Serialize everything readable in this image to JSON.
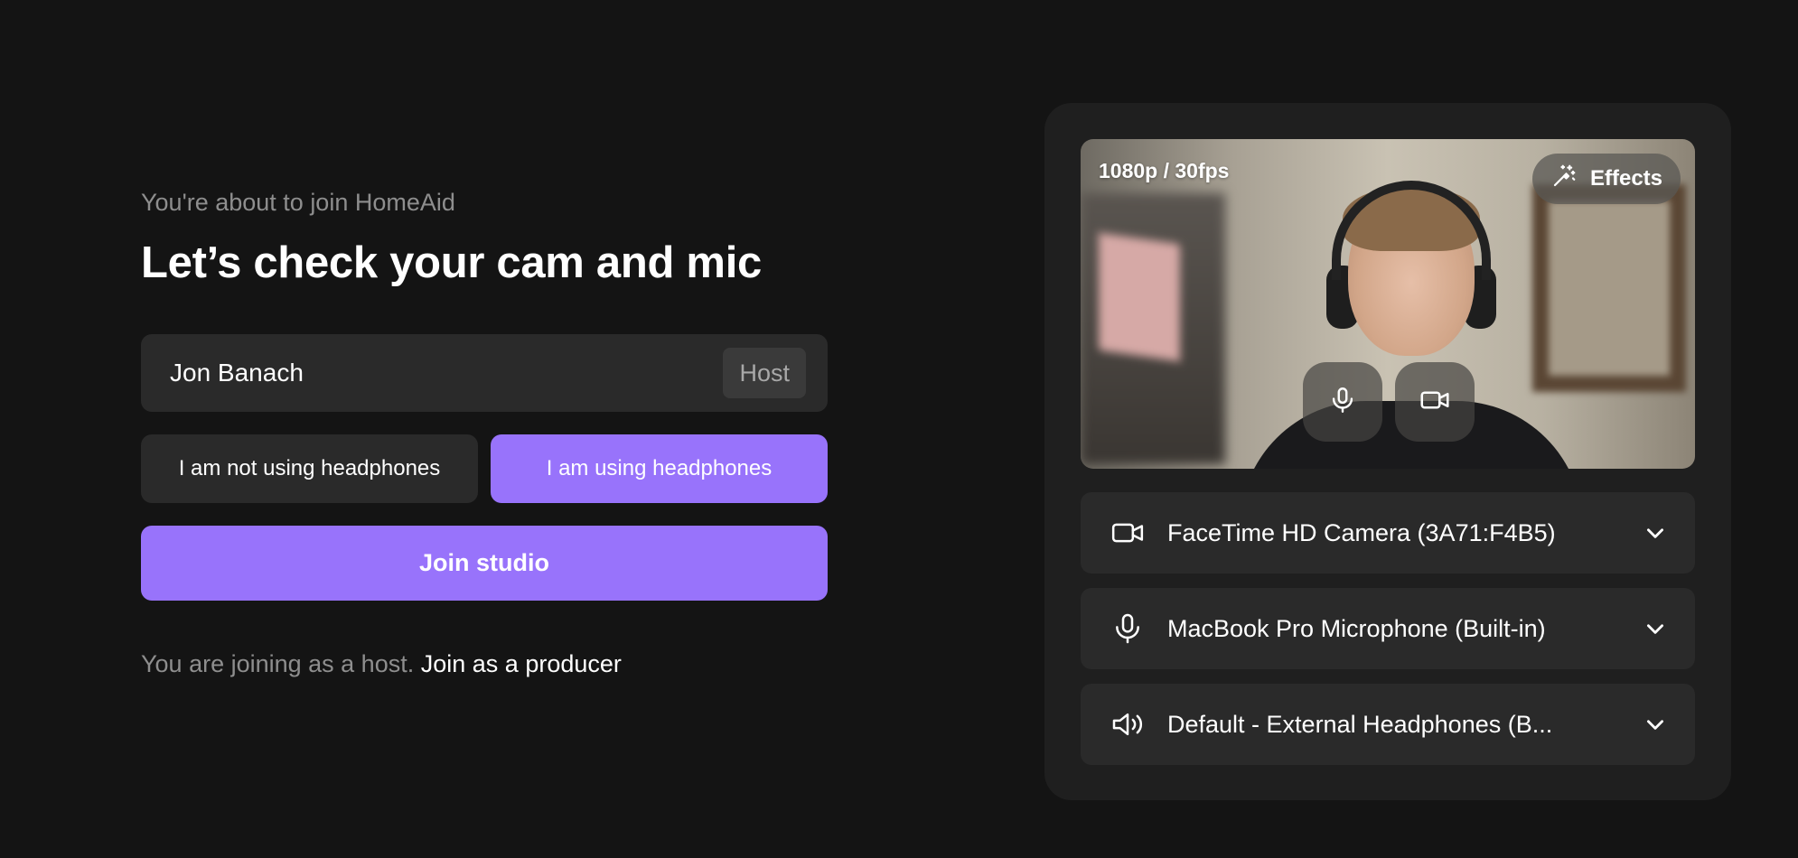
{
  "header": {
    "subtitle": "You're about to join HomeAid",
    "title": "Let’s check your cam and mic"
  },
  "name_field": {
    "value": "Jon Banach",
    "role": "Host"
  },
  "headphones": {
    "not_using_label": "I am not using headphones",
    "using_label": "I am using headphones",
    "selected": "using"
  },
  "join": {
    "button_label": "Join studio",
    "status_text": "You are joining as a host.",
    "producer_link": "Join as a producer"
  },
  "preview": {
    "resolution": "1080p / 30fps",
    "effects_label": "Effects"
  },
  "devices": {
    "camera": "FaceTime HD Camera (3A71:F4B5)",
    "microphone": "MacBook Pro Microphone (Built-in)",
    "speaker": "Default - External Headphones (B..."
  },
  "colors": {
    "background": "#141414",
    "panel": "#1f1f1f",
    "field": "#2a2a2a",
    "accent": "#9873fb",
    "muted_text": "#8e8e8e"
  },
  "icons": {
    "effects": "magic-wand-icon",
    "mic": "microphone-icon",
    "camera": "video-camera-icon",
    "speaker": "speaker-icon",
    "dropdown": "chevron-down-icon"
  }
}
